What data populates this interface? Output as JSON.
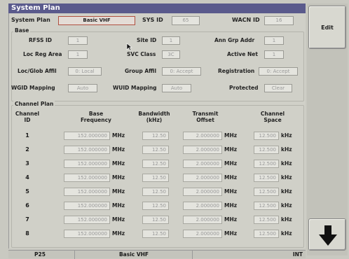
{
  "window": {
    "title": "System Plan"
  },
  "header": {
    "system_plan_label": "System Plan",
    "system_plan_value": "Basic VHF",
    "sys_id_label": "SYS ID",
    "sys_id_value": "65",
    "wacn_id_label": "WACN ID",
    "wacn_id_value": "16"
  },
  "base": {
    "title": "Base",
    "rfss_id_label": "RFSS ID",
    "rfss_id_value": "1",
    "site_id_label": "Site ID",
    "site_id_value": "1",
    "ann_grp_addr_label": "Ann Grp Addr",
    "ann_grp_addr_value": "1",
    "loc_reg_area_label": "Loc Reg Area",
    "loc_reg_area_value": "1",
    "svc_class_label": "SVC Class",
    "svc_class_value": "3C",
    "active_net_label": "Active Net",
    "active_net_value": "1",
    "loc_glob_affil_label": "Loc/Glob Affil",
    "loc_glob_affil_value": "0: Local",
    "group_affil_label": "Group Affil",
    "group_affil_value": "0: Accept",
    "registration_label": "Registration",
    "registration_value": "0: Accept",
    "wgid_mapping_label": "WGID Mapping",
    "wgid_mapping_value": "Auto",
    "wuid_mapping_label": "WUID Mapping",
    "wuid_mapping_value": "Auto",
    "protected_label": "Protected",
    "protected_value": "Clear"
  },
  "channel_plan": {
    "title": "Channel Plan",
    "headers": {
      "channel_id": [
        "Channel",
        "ID"
      ],
      "base_freq": [
        "Base",
        "Frequency"
      ],
      "bandwidth": [
        "Bandwidth",
        "(kHz)"
      ],
      "tx_offset": [
        "Transmit",
        "Offset"
      ],
      "ch_space": [
        "Channel",
        "Space"
      ]
    },
    "units": {
      "mhz": "MHz",
      "khz": "kHz"
    },
    "rows": [
      {
        "id": "1",
        "freq": "152.000000",
        "bw": "12.50",
        "offset": "2.000000",
        "space": "12.500"
      },
      {
        "id": "2",
        "freq": "152.000000",
        "bw": "12.50",
        "offset": "2.000000",
        "space": "12.500"
      },
      {
        "id": "3",
        "freq": "152.000000",
        "bw": "12.50",
        "offset": "2.000000",
        "space": "12.500"
      },
      {
        "id": "4",
        "freq": "152.000000",
        "bw": "12.50",
        "offset": "2.000000",
        "space": "12.500"
      },
      {
        "id": "5",
        "freq": "152.000000",
        "bw": "12.50",
        "offset": "2.000000",
        "space": "12.500"
      },
      {
        "id": "6",
        "freq": "152.000000",
        "bw": "12.50",
        "offset": "2.000000",
        "space": "12.500"
      },
      {
        "id": "7",
        "freq": "152.000000",
        "bw": "12.50",
        "offset": "2.000000",
        "space": "12.500"
      },
      {
        "id": "8",
        "freq": "152.000000",
        "bw": "12.50",
        "offset": "2.000000",
        "space": "12.500"
      }
    ]
  },
  "sidebar": {
    "edit_label": "Edit",
    "down_icon": "arrow-down-icon"
  },
  "status": {
    "left": "P25",
    "center": "Basic VHF",
    "right": "INT"
  },
  "colors": {
    "title_bg": "#5a5a8c",
    "panel_bg": "#d0d0c8",
    "accent_border": "#b05040"
  }
}
